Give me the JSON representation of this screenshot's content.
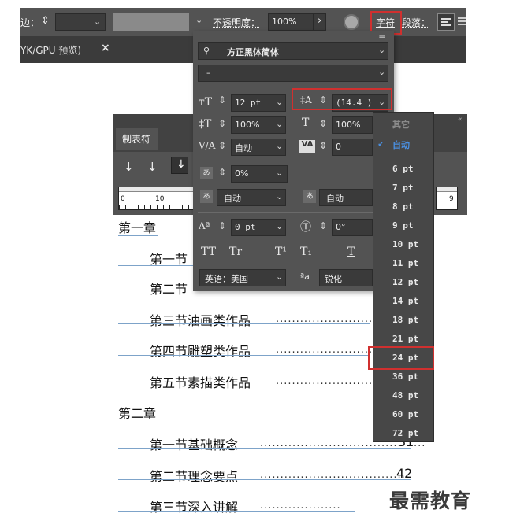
{
  "topbar": {
    "edge_label": "边：",
    "spinner": "◇",
    "opacity_label": "不透明度：",
    "opacity_value": "100%",
    "arrow": "›",
    "char_tab": "字符",
    "para_tab": "段落：",
    "chev": "⌄"
  },
  "doc_tab": {
    "label": "YK/GPU 预览)",
    "close": "×"
  },
  "tab_panel": {
    "title": "制表符",
    "ruler_marks": [
      "0",
      "10",
      "9"
    ]
  },
  "char_panel": {
    "font_family": "方正黑体简体",
    "font_style": "–",
    "font_size": "12 pt",
    "leading": "(14.4 )",
    "vert_scale": "100%",
    "horiz_scale": "100%",
    "kerning": "自动",
    "tracking": "0",
    "tsume": "0%",
    "aki_left": "自动",
    "aki_right": "自动",
    "baseline_shift": "0 pt",
    "rotation": "0°",
    "caps_buttons": [
      "TT",
      "Tr",
      "T¹",
      "T₁",
      "T"
    ],
    "language": "英语：美国",
    "aa_label": "ªa",
    "anti_alias": "锐化"
  },
  "size_list": {
    "header": "其它",
    "selected": "自动",
    "options": [
      "6 pt",
      "7 pt",
      "8 pt",
      "9 pt",
      "10 pt",
      "11 pt",
      "12 pt",
      "14 pt",
      "18 pt",
      "21 pt",
      "24 pt",
      "36 pt",
      "48 pt",
      "60 pt",
      "72 pt"
    ],
    "highlighted": "24 pt"
  },
  "toc": {
    "chapter1": "第一章",
    "c1s1": "第一节",
    "c1s2": "第二节",
    "c1s3": "第三节油画类作品",
    "c1s4": "第四节雕塑类作品",
    "c1s5": "第五节素描类作品",
    "chapter2": "第二章",
    "c2s1": "第一节基础概念",
    "c2s1_page": "31",
    "c2s2": "第二节理念要点",
    "c2s2_page": "42",
    "c2s3": "第三节深入讲解"
  },
  "watermark": "最需教育",
  "colors": {
    "panel": "#535353",
    "highlight": "#d0302f",
    "selected_check": "#4a90e2"
  }
}
